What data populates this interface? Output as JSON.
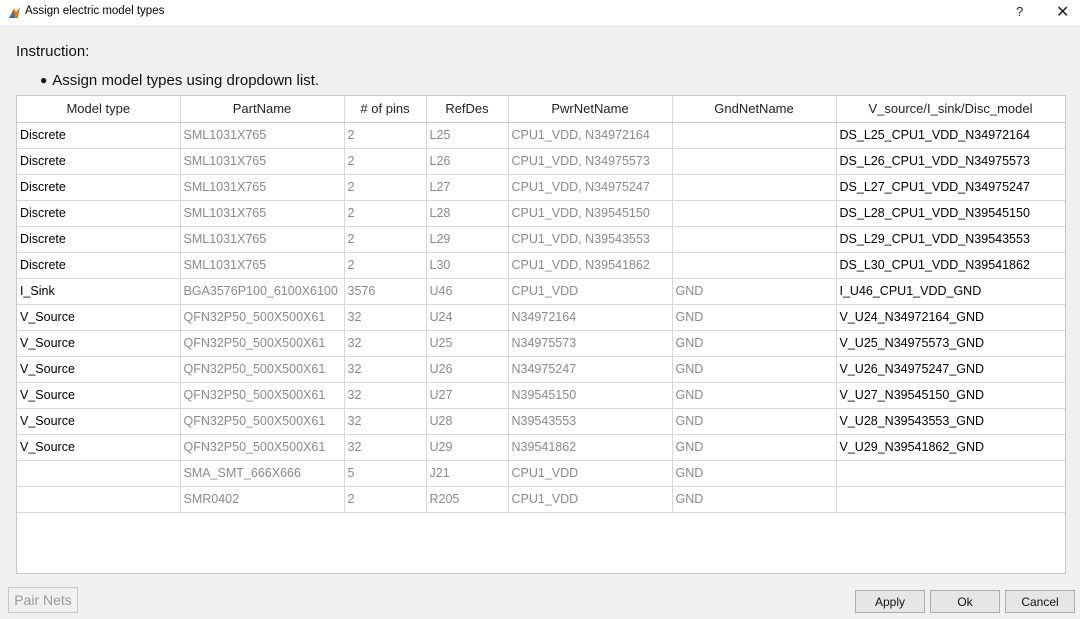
{
  "window": {
    "title": "Assign electric model types",
    "help_label": "?",
    "close_label": "✕"
  },
  "instruction": {
    "title": "Instruction:",
    "item": "Assign model types using dropdown list."
  },
  "table": {
    "columns": [
      "Model type",
      "PartName",
      "# of pins",
      "RefDes",
      "PwrNetName",
      "GndNetName",
      "V_source/I_sink/Disc_model"
    ],
    "rows": [
      [
        "Discrete",
        "SML1031X765",
        "2",
        "L25",
        "CPU1_VDD, N34972164",
        "",
        "DS_L25_CPU1_VDD_N34972164"
      ],
      [
        "Discrete",
        "SML1031X765",
        "2",
        "L26",
        "CPU1_VDD, N34975573",
        "",
        "DS_L26_CPU1_VDD_N34975573"
      ],
      [
        "Discrete",
        "SML1031X765",
        "2",
        "L27",
        "CPU1_VDD, N34975247",
        "",
        "DS_L27_CPU1_VDD_N34975247"
      ],
      [
        "Discrete",
        "SML1031X765",
        "2",
        "L28",
        "CPU1_VDD, N39545150",
        "",
        "DS_L28_CPU1_VDD_N39545150"
      ],
      [
        "Discrete",
        "SML1031X765",
        "2",
        "L29",
        "CPU1_VDD, N39543553",
        "",
        "DS_L29_CPU1_VDD_N39543553"
      ],
      [
        "Discrete",
        "SML1031X765",
        "2",
        "L30",
        "CPU1_VDD, N39541862",
        "",
        "DS_L30_CPU1_VDD_N39541862"
      ],
      [
        "I_Sink",
        "BGA3576P100_6100X6100",
        "3576",
        "U46",
        "CPU1_VDD",
        "GND",
        "I_U46_CPU1_VDD_GND"
      ],
      [
        "V_Source",
        "QFN32P50_500X500X61",
        "32",
        "U24",
        "N34972164",
        "GND",
        "V_U24_N34972164_GND"
      ],
      [
        "V_Source",
        "QFN32P50_500X500X61",
        "32",
        "U25",
        "N34975573",
        "GND",
        "V_U25_N34975573_GND"
      ],
      [
        "V_Source",
        "QFN32P50_500X500X61",
        "32",
        "U26",
        "N34975247",
        "GND",
        "V_U26_N34975247_GND"
      ],
      [
        "V_Source",
        "QFN32P50_500X500X61",
        "32",
        "U27",
        "N39545150",
        "GND",
        "V_U27_N39545150_GND"
      ],
      [
        "V_Source",
        "QFN32P50_500X500X61",
        "32",
        "U28",
        "N39543553",
        "GND",
        "V_U28_N39543553_GND"
      ],
      [
        "V_Source",
        "QFN32P50_500X500X61",
        "32",
        "U29",
        "N39541862",
        "GND",
        "V_U29_N39541862_GND"
      ],
      [
        "",
        "SMA_SMT_666X666",
        "5",
        "J21",
        "CPU1_VDD",
        "GND",
        ""
      ],
      [
        "",
        "SMR0402",
        "2",
        "R205",
        "CPU1_VDD",
        "GND",
        ""
      ]
    ]
  },
  "buttons": {
    "pair_nets": "Pair Nets",
    "apply": "Apply",
    "ok": "Ok",
    "cancel": "Cancel"
  },
  "colors": {
    "accent": "#e07a1f",
    "gray_text": "#8a8a8a"
  }
}
